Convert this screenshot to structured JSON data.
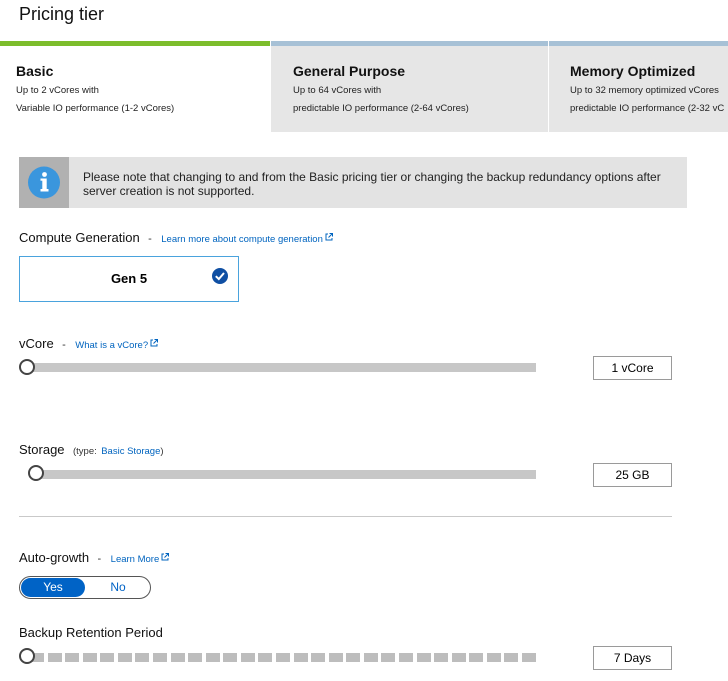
{
  "page": {
    "title": "Pricing tier"
  },
  "tiers": [
    {
      "name": "Basic",
      "desc1": "Up to 2 vCores with",
      "desc2": "Variable IO performance (1-2 vCores)",
      "selected": true
    },
    {
      "name": "General Purpose",
      "desc1": "Up to 64 vCores with",
      "desc2": "predictable IO performance (2-64 vCores)",
      "selected": false
    },
    {
      "name": "Memory Optimized",
      "desc1": "Up to 32 memory optimized vCores",
      "desc2": "predictable IO performance (2-32 vC",
      "selected": false
    }
  ],
  "notice": {
    "icon": "info-icon",
    "text": "Please note that changing to and from the Basic pricing tier or changing the backup redundancy options after server creation is not supported."
  },
  "compute": {
    "label": "Compute Generation",
    "separator": "-",
    "link": "Learn more about compute generation",
    "option": "Gen 5",
    "selected": true
  },
  "vcore": {
    "label": "vCore",
    "separator": "-",
    "link": "What is a vCore?",
    "value": "1 vCore",
    "slider_fraction": 0.0
  },
  "storage": {
    "label": "Storage",
    "type_prefix": "(type:",
    "type_value": "Basic Storage",
    "type_suffix": ")",
    "value": "25 GB",
    "slider_fraction": 0.0
  },
  "autogrowth": {
    "label": "Auto-growth",
    "separator": "-",
    "link": "Learn More",
    "yes": "Yes",
    "no": "No",
    "selected": "Yes"
  },
  "backup": {
    "label": "Backup Retention Period",
    "value": "7 Days",
    "slider_fraction": 0.0
  },
  "colors": {
    "selected_tab_accent": "#7cbd2c",
    "link": "#0064bf",
    "toggle_on": "#0063c6"
  }
}
